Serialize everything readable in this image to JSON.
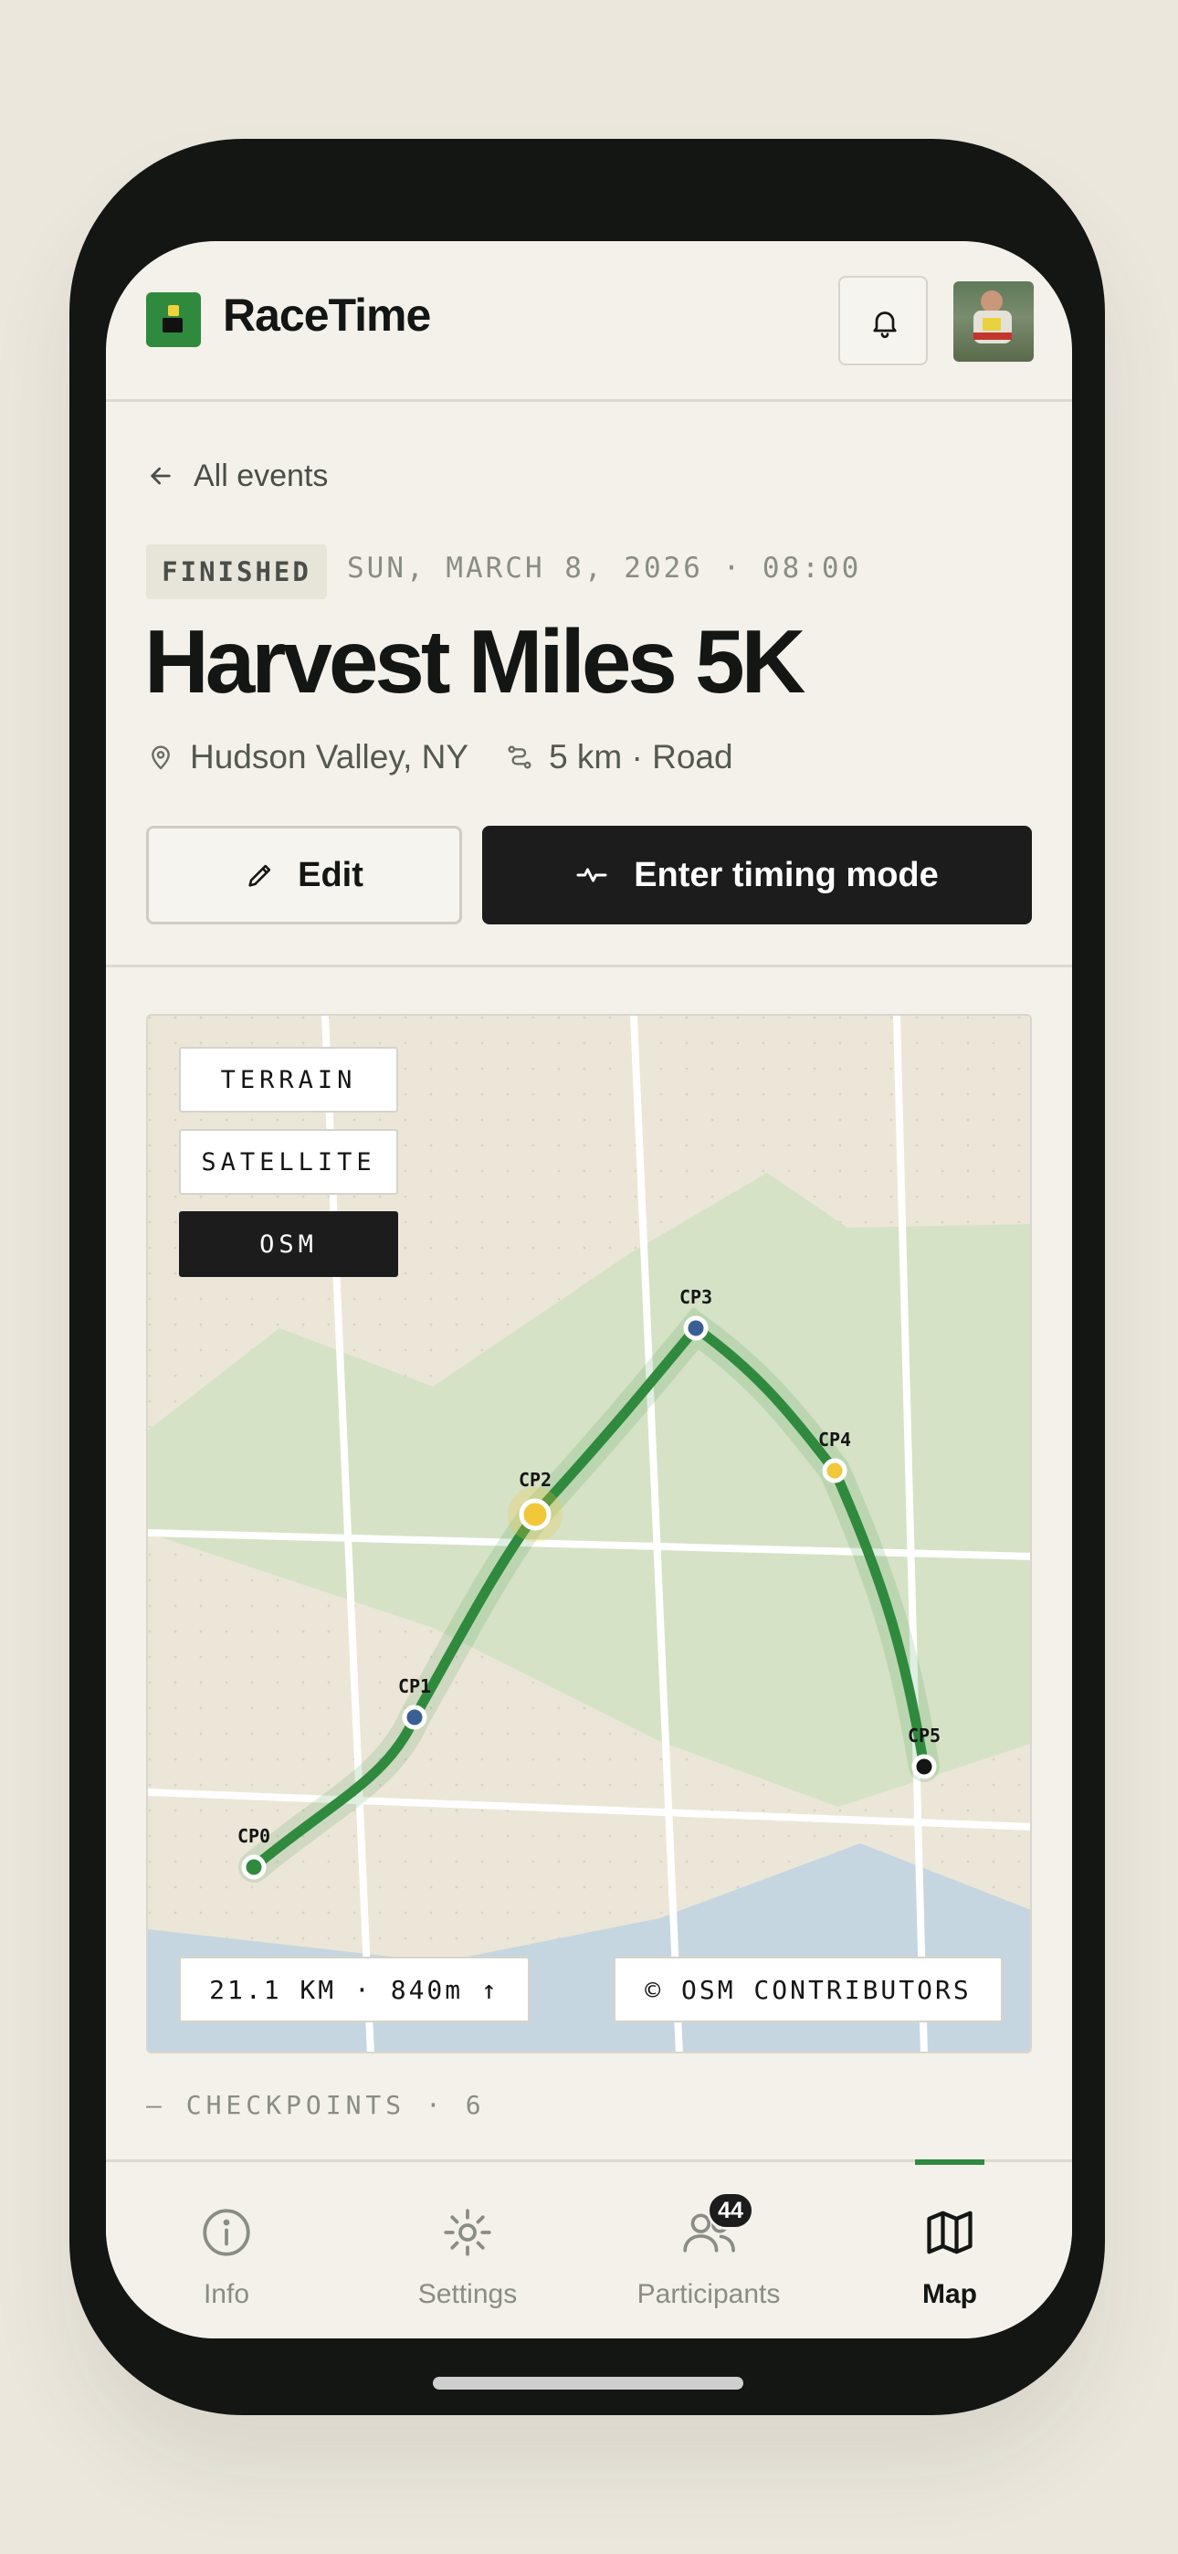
{
  "app": {
    "name": "RaceTime"
  },
  "header": {
    "notifications_icon": "bell-icon",
    "avatar_alt": "user-avatar"
  },
  "nav": {
    "back_label": "All events"
  },
  "event": {
    "status": "FINISHED",
    "date": "SUN, MARCH 8, 2026 · 08:00",
    "title": "Harvest Miles 5K",
    "location": "Hudson Valley, NY",
    "distance_type": "5 km · Road"
  },
  "actions": {
    "edit_label": "Edit",
    "timing_label": "Enter timing mode"
  },
  "map": {
    "layers": [
      "TERRAIN",
      "SATELLITE",
      "OSM"
    ],
    "active_layer": "OSM",
    "checkpoints": [
      {
        "label": "CP0",
        "color": "#2f8a3e"
      },
      {
        "label": "CP1",
        "color": "#3a5f95"
      },
      {
        "label": "CP2",
        "color": "#f0c83a"
      },
      {
        "label": "CP3",
        "color": "#3a5f95"
      },
      {
        "label": "CP4",
        "color": "#f0c83a"
      },
      {
        "label": "CP5",
        "color": "#141614"
      }
    ],
    "stats": "21.1 KM · 840m ↑",
    "attribution": "© OSM CONTRIBUTORS",
    "route_color": "#2f8a3e"
  },
  "checkpoints_section": {
    "label": "— CHECKPOINTS · 6"
  },
  "tabs": [
    {
      "label": "Info",
      "icon": "info-icon"
    },
    {
      "label": "Settings",
      "icon": "gear-icon"
    },
    {
      "label": "Participants",
      "icon": "users-icon",
      "badge": "44"
    },
    {
      "label": "Map",
      "icon": "map-icon",
      "active": true
    }
  ],
  "colors": {
    "accent": "#2f8a3e",
    "dark": "#1b1c1b",
    "background": "#f3f1ea"
  }
}
